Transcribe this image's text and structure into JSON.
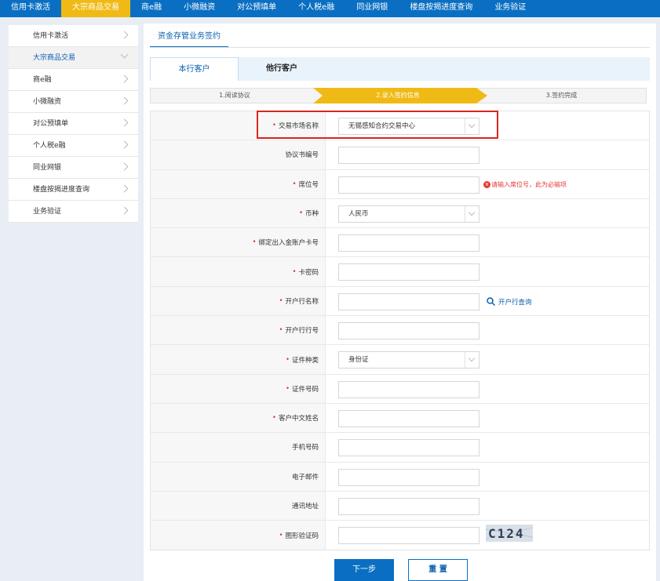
{
  "top_nav": [
    {
      "label": "信用卡激活",
      "active": false
    },
    {
      "label": "大宗商品交易",
      "active": true
    },
    {
      "label": "商e融",
      "active": false
    },
    {
      "label": "小微融资",
      "active": false
    },
    {
      "label": "对公预填单",
      "active": false
    },
    {
      "label": "个人税e融",
      "active": false
    },
    {
      "label": "同业网银",
      "active": false
    },
    {
      "label": "楼盘按揭进度查询",
      "active": false
    },
    {
      "label": "业务验证",
      "active": false
    }
  ],
  "sidebar": [
    {
      "label": "信用卡激活"
    },
    {
      "label": "大宗商品交易"
    },
    {
      "label": "商e融"
    },
    {
      "label": "小微融资"
    },
    {
      "label": "对公预填单"
    },
    {
      "label": "个人税e融"
    },
    {
      "label": "同业网银"
    },
    {
      "label": "楼盘按揭进度查询"
    },
    {
      "label": "业务验证"
    }
  ],
  "main": {
    "title": "资金存管业务签约",
    "tabs": {
      "own": "本行客户",
      "other": "他行客户"
    },
    "steps": [
      "1.阅读协议",
      "2.录入签约信息",
      "3.签约完成"
    ]
  },
  "form": {
    "rows": [
      {
        "label": "交易市场名称",
        "required": true,
        "value": "无锡感知合约交易中心"
      },
      {
        "label": "协议书编号",
        "required": false,
        "value": ""
      },
      {
        "label": "席位号",
        "required": true,
        "value": "",
        "error": "请输入席位号，此为必输项"
      },
      {
        "label": "币种",
        "required": true,
        "value": "人民币"
      },
      {
        "label": "绑定出入金账户卡号",
        "required": true,
        "value": ""
      },
      {
        "label": "卡密码",
        "required": true,
        "value": ""
      },
      {
        "label": "开户行名称",
        "required": true,
        "value": "",
        "link": "开户行查询"
      },
      {
        "label": "开户行行号",
        "required": true,
        "value": ""
      },
      {
        "label": "证件种类",
        "required": true,
        "value": "身份证"
      },
      {
        "label": "证件号码",
        "required": true,
        "value": ""
      },
      {
        "label": "客户中文姓名",
        "required": true,
        "value": ""
      },
      {
        "label": "手机号码",
        "required": false,
        "value": ""
      },
      {
        "label": "电子邮件",
        "required": false,
        "value": ""
      },
      {
        "label": "通讯地址",
        "required": false,
        "value": ""
      },
      {
        "label": "图形验证码",
        "required": true,
        "value": "",
        "captcha": "C124"
      }
    ],
    "error_x": "x"
  },
  "buttons": {
    "next": "下一步",
    "reset": "重 置"
  },
  "colors": {
    "primary": "#0a6fc2",
    "accent": "#f0ba16",
    "error": "#e53935"
  }
}
